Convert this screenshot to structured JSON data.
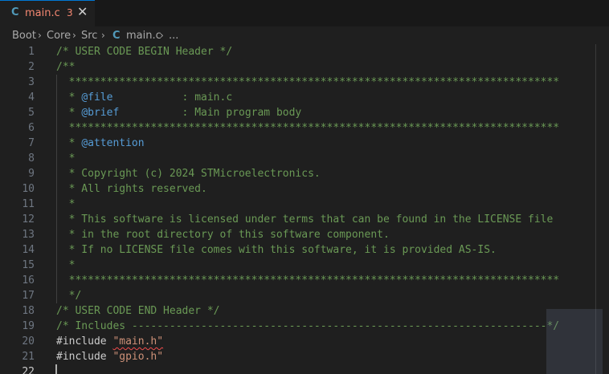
{
  "tab": {
    "icon": "C",
    "title": "main.c",
    "problem_count": "3",
    "close_glyph": "✕"
  },
  "breadcrumb": {
    "items": [
      "Boot",
      "Core",
      "Src",
      "main.c",
      "..."
    ],
    "separator": "›",
    "file_icon": "C"
  },
  "editor": {
    "active_line": 22,
    "lines": [
      {
        "n": "1",
        "text": "/* USER CODE BEGIN Header */"
      },
      {
        "n": "2",
        "text": "/**"
      },
      {
        "n": "3",
        "text": "  ******************************************************************************"
      },
      {
        "n": "4",
        "pre": "  * ",
        "tag": "@file",
        "post": "           : main.c"
      },
      {
        "n": "5",
        "pre": "  * ",
        "tag": "@brief",
        "post": "          : Main program body"
      },
      {
        "n": "6",
        "text": "  ******************************************************************************"
      },
      {
        "n": "7",
        "pre": "  * ",
        "tag": "@attention",
        "post": ""
      },
      {
        "n": "8",
        "text": "  *"
      },
      {
        "n": "9",
        "text": "  * Copyright (c) 2024 STMicroelectronics."
      },
      {
        "n": "10",
        "text": "  * All rights reserved."
      },
      {
        "n": "11",
        "text": "  *"
      },
      {
        "n": "12",
        "text": "  * This software is licensed under terms that can be found in the LICENSE file"
      },
      {
        "n": "13",
        "text": "  * in the root directory of this software component."
      },
      {
        "n": "14",
        "text": "  * If no LICENSE file comes with this software, it is provided AS-IS."
      },
      {
        "n": "15",
        "text": "  *"
      },
      {
        "n": "16",
        "text": "  ******************************************************************************"
      },
      {
        "n": "17",
        "text": "  */"
      },
      {
        "n": "18",
        "text": "/* USER CODE END Header */"
      },
      {
        "n": "19",
        "text": "/* Includes ------------------------------------------------------------------*/"
      },
      {
        "n": "20",
        "directive": "#include",
        "string": "\"main.h\"",
        "error": true
      },
      {
        "n": "21",
        "directive": "#include",
        "string": "\"gpio.h\"",
        "error": false
      },
      {
        "n": "22",
        "text": ""
      }
    ]
  },
  "colors": {
    "comment": "#6a9955",
    "doc_tag": "#569cd6",
    "string": "#ce9178",
    "error": "#f48771",
    "accent": "#0078d4"
  }
}
